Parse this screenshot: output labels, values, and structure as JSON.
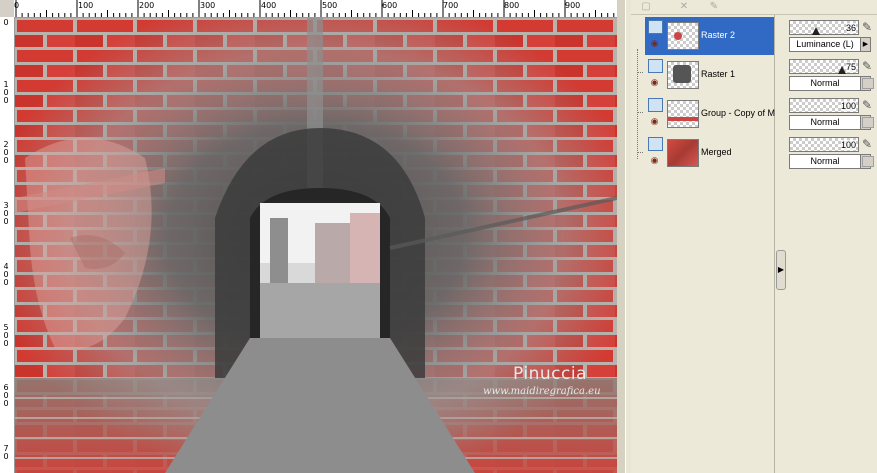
{
  "ruler": {
    "top_labels": [
      "0",
      "100",
      "200",
      "300",
      "400",
      "500",
      "600",
      "700",
      "800",
      "900"
    ],
    "left_labels": [
      "0",
      "1\n0\n0",
      "2\n0\n0",
      "3\n0\n0",
      "4\n0\n0",
      "5\n0\n0",
      "6\n0\n0",
      "7\n0"
    ]
  },
  "canvas": {
    "watermark_name": "Pinuccia",
    "watermark_url": "www.maidiregrafica.eu",
    "colors": {
      "brick_red": "#d23a32",
      "mortar": "#b9b3ad",
      "stone_gray": "#6e6e6e"
    }
  },
  "layers": [
    {
      "name": "Raster 2",
      "selected": true,
      "opacity": "36",
      "opacity_fraction": 0.36,
      "blend_mode": "Luminance (L)"
    },
    {
      "name": "Raster 1",
      "selected": false,
      "opacity": "75",
      "opacity_fraction": 0.75,
      "blend_mode": "Normal"
    },
    {
      "name": "Group - Copy of M",
      "selected": false,
      "opacity": "100",
      "opacity_fraction": 1.0,
      "blend_mode": "Normal"
    },
    {
      "name": "Merged",
      "selected": false,
      "opacity": "100",
      "opacity_fraction": 1.0,
      "blend_mode": "Normal"
    }
  ],
  "icons": {
    "layer_type": "raster-layer-icon",
    "visibility": "eye-icon",
    "edit": "brush-icon",
    "lock": "lock-icon",
    "toolbar": [
      "new-layer-icon",
      "delete-layer-icon",
      "edit-icon"
    ]
  },
  "accent": "#316ac5"
}
